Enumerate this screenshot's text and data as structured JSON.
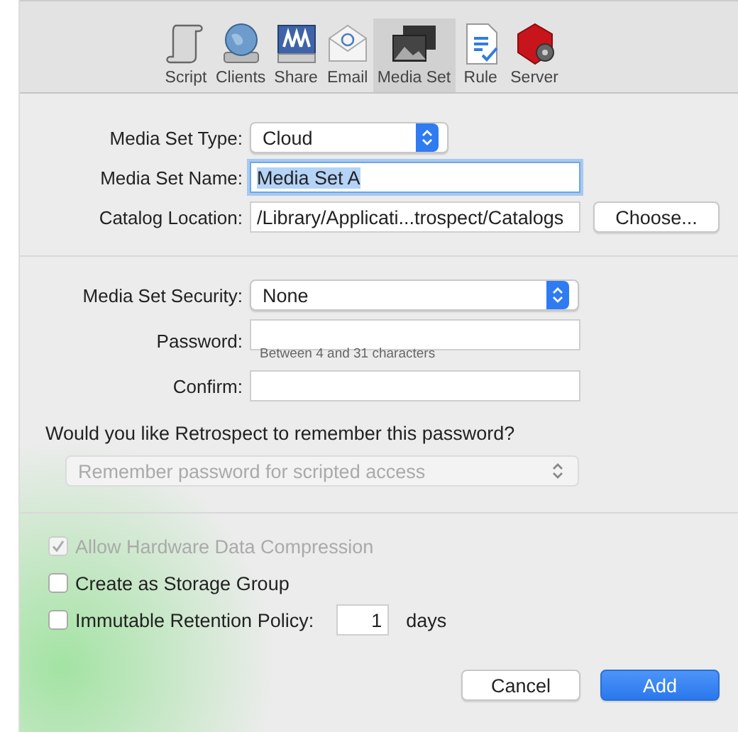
{
  "toolbar": {
    "items": [
      {
        "label": "Script",
        "selected": false
      },
      {
        "label": "Clients",
        "selected": false
      },
      {
        "label": "Share",
        "selected": false
      },
      {
        "label": "Email",
        "selected": false
      },
      {
        "label": "Media Set",
        "selected": true
      },
      {
        "label": "Rule",
        "selected": false
      },
      {
        "label": "Server",
        "selected": false
      }
    ]
  },
  "media_set": {
    "rows": [
      {
        "kind": "popup",
        "label": "Media Set Type:",
        "value": "Cloud"
      },
      {
        "kind": "text",
        "label": "Media Set Name:",
        "value": "Media Set A",
        "focused": true,
        "text_selected": true
      },
      {
        "kind": "path",
        "label": "Catalog Location:",
        "value": "/Library/Applicati...trospect/Catalogs",
        "button": "Choose..."
      }
    ]
  },
  "security": {
    "rows": [
      {
        "kind": "popup",
        "label": "Media Set Security:",
        "value": "None"
      },
      {
        "kind": "text",
        "label": "Password:",
        "hint": "Between 4 and 31 characters"
      },
      {
        "kind": "text",
        "label": "Confirm:"
      }
    ],
    "question": "Would you like Retrospect to remember this password?",
    "remember_popup": {
      "value": "Remember password for scripted access",
      "disabled": true
    }
  },
  "options": [
    {
      "label": "Allow Hardware Data Compression",
      "checked": true,
      "disabled": true
    },
    {
      "label": "Create as Storage Group",
      "checked": false,
      "disabled": false
    },
    {
      "label": "Immutable Retention Policy:",
      "checked": false,
      "disabled": false,
      "days_value": "1",
      "days_unit": "days"
    }
  ],
  "buttons": [
    {
      "label": "Cancel",
      "default": false
    },
    {
      "label": "Add",
      "default": true
    }
  ]
}
